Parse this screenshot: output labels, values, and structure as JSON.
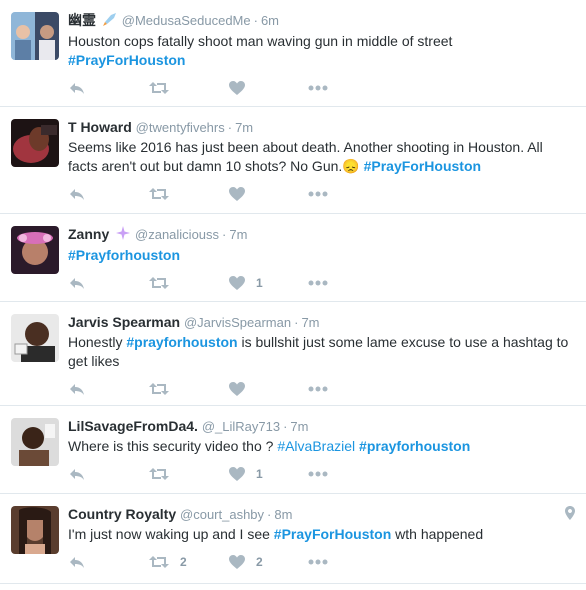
{
  "tweets": [
    {
      "name": "幽霊",
      "handle": "@MedusaSeducedMe",
      "time": "6m",
      "segments": [
        {
          "text": "Houston cops fatally shoot man waving gun in middle of street ",
          "type": "text"
        },
        {
          "text": "#PrayForHouston",
          "type": "tag"
        }
      ],
      "retweets": "",
      "likes": ""
    },
    {
      "name": "T Howard",
      "handle": "@twentyfivehrs",
      "time": "7m",
      "segments": [
        {
          "text": "Seems like 2016 has just been about death. Another shooting in Houston. All facts aren't out but damn 10 shots? No Gun.",
          "type": "text"
        },
        {
          "text": "😞",
          "type": "text"
        },
        {
          "text": " ",
          "type": "text"
        },
        {
          "text": "#PrayForHouston",
          "type": "tag"
        }
      ],
      "retweets": "",
      "likes": ""
    },
    {
      "name": "Zanny",
      "handle": "@zanaliciouss",
      "time": "7m",
      "segments": [
        {
          "text": "#Prayforhouston",
          "type": "tag"
        }
      ],
      "retweets": "",
      "likes": "1"
    },
    {
      "name": "Jarvis Spearman",
      "handle": "@JarvisSpearman",
      "time": "7m",
      "segments": [
        {
          "text": "Honestly ",
          "type": "text"
        },
        {
          "text": "#prayforhouston",
          "type": "tag"
        },
        {
          "text": " is bullshit just some lame excuse to use a hashtag to get likes",
          "type": "text"
        }
      ],
      "retweets": "",
      "likes": ""
    },
    {
      "name": "LilSavageFromDa4.",
      "handle": "@_LilRay713",
      "time": "7m",
      "segments": [
        {
          "text": "Where is this security video tho ? ",
          "type": "text"
        },
        {
          "text": "#AlvaBraziel",
          "type": "tag-plain"
        },
        {
          "text": " ",
          "type": "text"
        },
        {
          "text": "#prayforhouston",
          "type": "tag"
        }
      ],
      "retweets": "",
      "likes": "1"
    },
    {
      "name": "Country Royalty",
      "handle": "@court_ashby",
      "time": "8m",
      "segments": [
        {
          "text": "I'm just now waking up and I see ",
          "type": "text"
        },
        {
          "text": "#PrayForHouston",
          "type": "tag"
        },
        {
          "text": " wth happened",
          "type": "text"
        }
      ],
      "retweets": "2",
      "likes": "2"
    }
  ],
  "dot_separator": "·",
  "icons": {
    "reply": "reply-icon",
    "retweet": "retweet-icon",
    "like": "heart-icon",
    "more": "more-icon",
    "location": "location-pin-icon"
  },
  "colors": {
    "hashtag": "#1b95e0",
    "muted": "#8899a6",
    "icon": "#aab8c2",
    "text": "#292f33",
    "divider": "#e1e8ed"
  }
}
